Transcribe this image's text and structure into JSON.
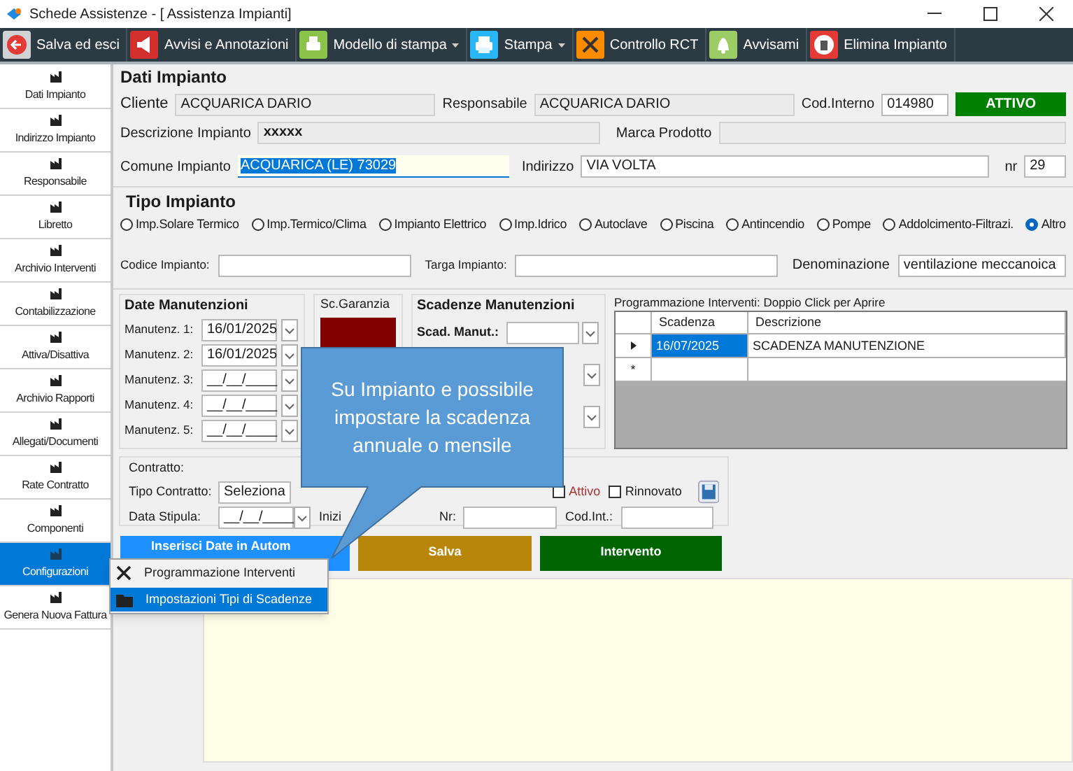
{
  "window": {
    "title": "Schede Assistenze - [ Assistenza Impianti]"
  },
  "toolbar": [
    {
      "label": "Salva ed esci",
      "dropdown": false
    },
    {
      "label": "Avvisi e Annotazioni",
      "dropdown": false
    },
    {
      "label": "Modello di stampa",
      "dropdown": true
    },
    {
      "label": "Stampa",
      "dropdown": true
    },
    {
      "label": "Controllo RCT",
      "dropdown": false
    },
    {
      "label": "Avvisami",
      "dropdown": false
    },
    {
      "label": "Elimina Impianto",
      "dropdown": false
    }
  ],
  "sidebar": {
    "items": [
      {
        "label": "Dati Impianto",
        "selected": false
      },
      {
        "label": "Indirizzo Impianto",
        "selected": false
      },
      {
        "label": "Responsabile",
        "selected": false
      },
      {
        "label": "Libretto",
        "selected": false
      },
      {
        "label": "Archivio Interventi",
        "selected": false
      },
      {
        "label": "Contabilizzazione",
        "selected": false
      },
      {
        "label": "Attiva/Disattiva",
        "selected": false
      },
      {
        "label": "Archivio Rapporti",
        "selected": false
      },
      {
        "label": "Allegati/Documenti",
        "selected": false
      },
      {
        "label": "Rate Contratto",
        "selected": false
      },
      {
        "label": "Componenti",
        "selected": false
      },
      {
        "label": "Configurazioni",
        "selected": true
      },
      {
        "label": "Genera Nuova Fattura",
        "selected": false
      }
    ]
  },
  "dati_impianto": {
    "title": "Dati Impianto",
    "cliente": {
      "label": "Cliente",
      "value": "ACQUARICA DARIO"
    },
    "responsabile": {
      "label": "Responsabile",
      "value": "ACQUARICA DARIO"
    },
    "cod_interno": {
      "label": "Cod.Interno",
      "value": "014980"
    },
    "status": "ATTIVO",
    "descrizione": {
      "label": "Descrizione Impianto",
      "value": "xxxxx"
    },
    "marca": {
      "label": "Marca Prodotto"
    },
    "comune": {
      "label": "Comune Impianto",
      "value": "ACQUARICA (LE) 73029",
      "selected": true
    },
    "indirizzo": {
      "label": "Indirizzo",
      "value": "VIA VOLTA"
    },
    "nr": {
      "label": "nr",
      "value": "29"
    }
  },
  "tipo_impianto": {
    "title": "Tipo Impianto",
    "options": [
      {
        "label": "Imp.Solare Termico",
        "selected": false
      },
      {
        "label": "Imp.Termico/Clima",
        "selected": false
      },
      {
        "label": "Impianto Elettrico",
        "selected": false
      },
      {
        "label": "Imp.Idrico",
        "selected": false
      },
      {
        "label": "Autoclave",
        "selected": false
      },
      {
        "label": "Piscina",
        "selected": false
      },
      {
        "label": "Antincendio",
        "selected": false
      },
      {
        "label": "Pompe",
        "selected": false
      },
      {
        "label": "Addolcimento-Filtrazi.",
        "selected": false
      },
      {
        "label": "Altro",
        "selected": true
      }
    ],
    "codice": {
      "label": "Codice Impianto:"
    },
    "targa": {
      "label": "Targa Impianto:"
    },
    "denominazione": {
      "label": "Denominazione",
      "value": "ventilazione meccanoica"
    }
  },
  "date_manutenzioni": {
    "title": "Date Manutenzioni",
    "rows": [
      {
        "label": "Manutenz. 1:",
        "value": "16/01/2025"
      },
      {
        "label": "Manutenz. 2:",
        "value": "16/01/2025"
      },
      {
        "label": "Manutenz. 3:",
        "value": "__/__/____"
      },
      {
        "label": "Manutenz. 4:",
        "value": "__/__/____"
      },
      {
        "label": "Manutenz. 5:",
        "value": "__/__/____"
      }
    ]
  },
  "sc_garanzia": {
    "title": "Sc.Garanzia"
  },
  "scadenze_manutenzioni": {
    "title": "Scadenze Manutenzioni",
    "label": "Scad. Manut.:"
  },
  "programmazione": {
    "title": "Programmazione Interventi: Doppio Click per Aprire",
    "columns": [
      "Scadenza",
      "Descrizione"
    ],
    "rows": [
      {
        "cells": [
          "16/07/2025",
          "SCADENZA MANUTENZIONE"
        ],
        "selected": true
      }
    ],
    "new_row_marker": "*"
  },
  "contratto": {
    "title": "Contratto:",
    "tipo": {
      "label": "Tipo Contratto:",
      "value": "Seleziona"
    },
    "attivo": {
      "label": "Attivo",
      "checked": false
    },
    "rinnovato": {
      "label": "Rinnovato",
      "checked": false
    },
    "data_stipula": {
      "label": "Data Stipula:",
      "value": "__/__/____"
    },
    "inizio": {
      "label": "Inizi"
    },
    "nr": {
      "label": "Nr:"
    },
    "cod_int": {
      "label": "Cod.Int.:"
    }
  },
  "actions": [
    {
      "label": "Inserisci Date in Autom",
      "kind": "insert"
    },
    {
      "label": "Salva",
      "kind": "save"
    },
    {
      "label": "Intervento",
      "kind": "intervention"
    }
  ],
  "callout": {
    "text": "Su Impianto e possibile impostare la scadenza annuale o mensile"
  },
  "context_menu": {
    "items": [
      {
        "label": "Programmazione Interventi",
        "selected": false
      },
      {
        "label": "Impostazioni Tipi di Scadenze",
        "selected": true
      }
    ]
  }
}
